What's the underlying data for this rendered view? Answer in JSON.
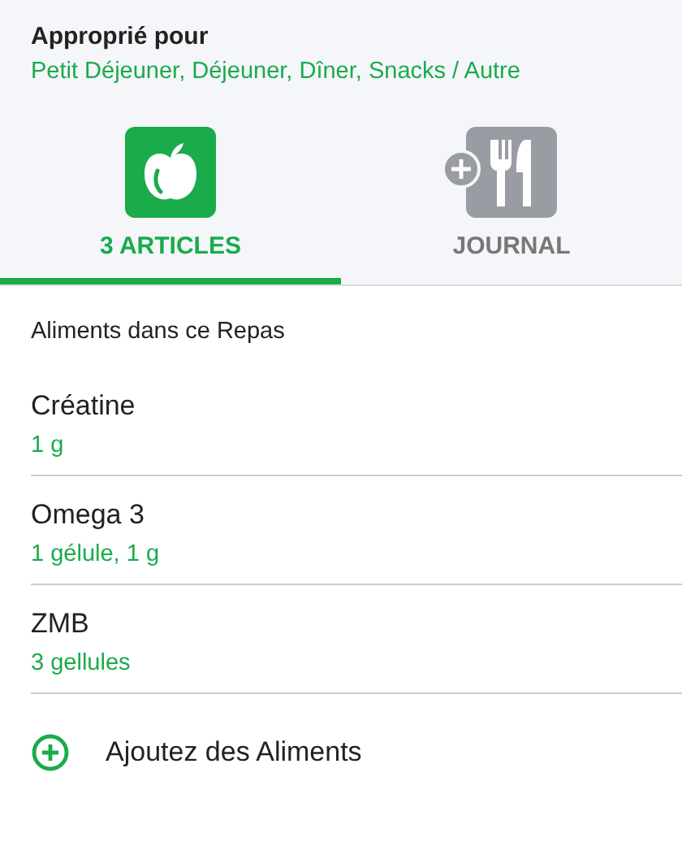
{
  "suitable": {
    "title": "Approprié pour",
    "meals": "Petit Déjeuner, Déjeuner, Dîner, Snacks / Autre"
  },
  "tabs": [
    {
      "label": "3 ARTICLES",
      "kind": "apple",
      "selected": true
    },
    {
      "label": "JOURNAL",
      "kind": "cutlery",
      "selected": false
    }
  ],
  "section_title": "Aliments dans ce Repas",
  "foods": [
    {
      "name": "Créatine",
      "amount": "1 g"
    },
    {
      "name": "Omega 3",
      "amount": "1 gélule, 1 g"
    },
    {
      "name": "ZMB",
      "amount": "3 gellules"
    }
  ],
  "add_label": "Ajoutez des Aliments"
}
